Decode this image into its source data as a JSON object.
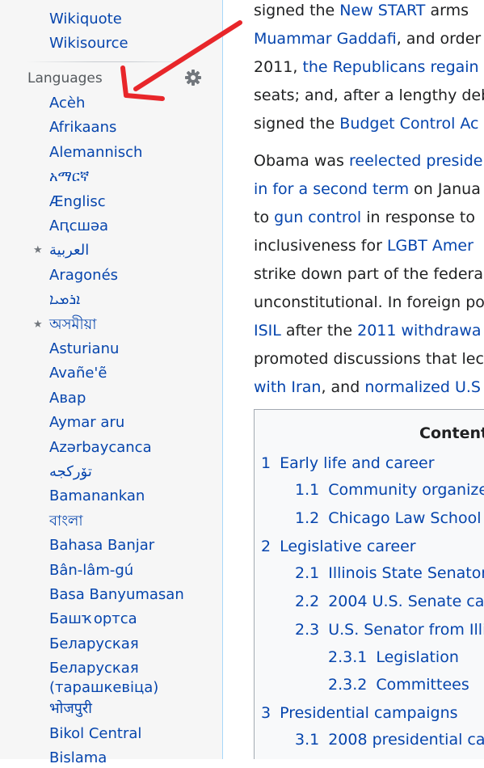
{
  "sidebar": {
    "projects": [
      "Wikiquote",
      "Wikisource"
    ],
    "languages_heading": "Languages",
    "languages": [
      {
        "label": "Acèh",
        "starred": false
      },
      {
        "label": "Afrikaans",
        "starred": false
      },
      {
        "label": "Alemannisch",
        "starred": false
      },
      {
        "label": "አማርኛ",
        "starred": false
      },
      {
        "label": "Ænglisc",
        "starred": false
      },
      {
        "label": "Аԥсшәа",
        "starred": false
      },
      {
        "label": "العربية",
        "starred": true
      },
      {
        "label": "Aragonés",
        "starred": false
      },
      {
        "label": "ܐܪܡܝܐ",
        "starred": false
      },
      {
        "label": "অসমীয়া",
        "starred": true
      },
      {
        "label": "Asturianu",
        "starred": false
      },
      {
        "label": "Avañe'ẽ",
        "starred": false
      },
      {
        "label": "Авар",
        "starred": false
      },
      {
        "label": "Aymar aru",
        "starred": false
      },
      {
        "label": "Azərbaycanca",
        "starred": false
      },
      {
        "label": "تۆرکجه",
        "starred": false
      },
      {
        "label": "Bamanankan",
        "starred": false
      },
      {
        "label": "বাংলা",
        "starred": false
      },
      {
        "label": "Bahasa Banjar",
        "starred": false
      },
      {
        "label": "Bân-lâm-gú",
        "starred": false
      },
      {
        "label": "Basa Banyumasan",
        "starred": false
      },
      {
        "label": "Башҡортса",
        "starred": false
      },
      {
        "label": "Беларуская",
        "starred": false
      },
      {
        "label": "Беларуская (тарашкевіца)",
        "starred": false
      },
      {
        "label": "भोजपुरी",
        "starred": false
      },
      {
        "label": "Bikol Central",
        "starred": false
      },
      {
        "label": "Bislama",
        "starred": false
      }
    ]
  },
  "article": {
    "lines": [
      [
        {
          "t": "signed the "
        },
        {
          "t": "New START",
          "link": true
        },
        {
          "t": " arms"
        }
      ],
      [
        {
          "t": "Muammar Gaddafi",
          "link": true
        },
        {
          "t": ", and order"
        }
      ],
      [
        {
          "t": "2011, "
        },
        {
          "t": "the Republicans regain",
          "link": true
        }
      ],
      [
        {
          "t": "seats; and, after a lengthy deb"
        }
      ],
      [
        {
          "t": "signed the "
        },
        {
          "t": "Budget Control Ac",
          "link": true
        }
      ],
      [
        {
          "t": "Obama was "
        },
        {
          "t": "reelected preside",
          "link": true
        }
      ],
      [
        {
          "t": "in for a second term",
          "link": true
        },
        {
          "t": " on Janua"
        }
      ],
      [
        {
          "t": "to "
        },
        {
          "t": "gun control",
          "link": true
        },
        {
          "t": " in response to"
        }
      ],
      [
        {
          "t": "inclusiveness for "
        },
        {
          "t": "LGBT Amer",
          "link": true
        }
      ],
      [
        {
          "t": "strike down part of the federa"
        }
      ],
      [
        {
          "t": "unconstitutional. In foreign po"
        }
      ],
      [
        {
          "t": "ISIL",
          "link": true
        },
        {
          "t": " after the "
        },
        {
          "t": "2011 withdrawa",
          "link": true
        }
      ],
      [
        {
          "t": "promoted discussions that lec"
        }
      ],
      [
        {
          "t": "with Iran",
          "link": true
        },
        {
          "t": ", and "
        },
        {
          "t": "normalized U.S",
          "link": true
        }
      ]
    ]
  },
  "toc": {
    "title": "Contents",
    "items": [
      {
        "num": "1",
        "label": "Early life and career",
        "level": 1
      },
      {
        "num": "1.1",
        "label": "Community organizer",
        "level": 2
      },
      {
        "num": "1.2",
        "label": "Chicago Law School",
        "level": 2
      },
      {
        "num": "2",
        "label": "Legislative career",
        "level": 1
      },
      {
        "num": "2.1",
        "label": "Illinois State Senator",
        "level": 2
      },
      {
        "num": "2.2",
        "label": "2004 U.S. Senate ca",
        "level": 2
      },
      {
        "num": "2.3",
        "label": "U.S. Senator from Illi",
        "level": 2
      },
      {
        "num": "2.3.1",
        "label": "Legislation",
        "level": 3
      },
      {
        "num": "2.3.2",
        "label": "Committees",
        "level": 3
      },
      {
        "num": "3",
        "label": "Presidential campaigns",
        "level": 1
      },
      {
        "num": "3.1",
        "label": "2008 presidential car",
        "level": 2
      }
    ]
  },
  "colors": {
    "link": "#0645ad",
    "arrow": "#e8262a",
    "text": "#202122"
  }
}
